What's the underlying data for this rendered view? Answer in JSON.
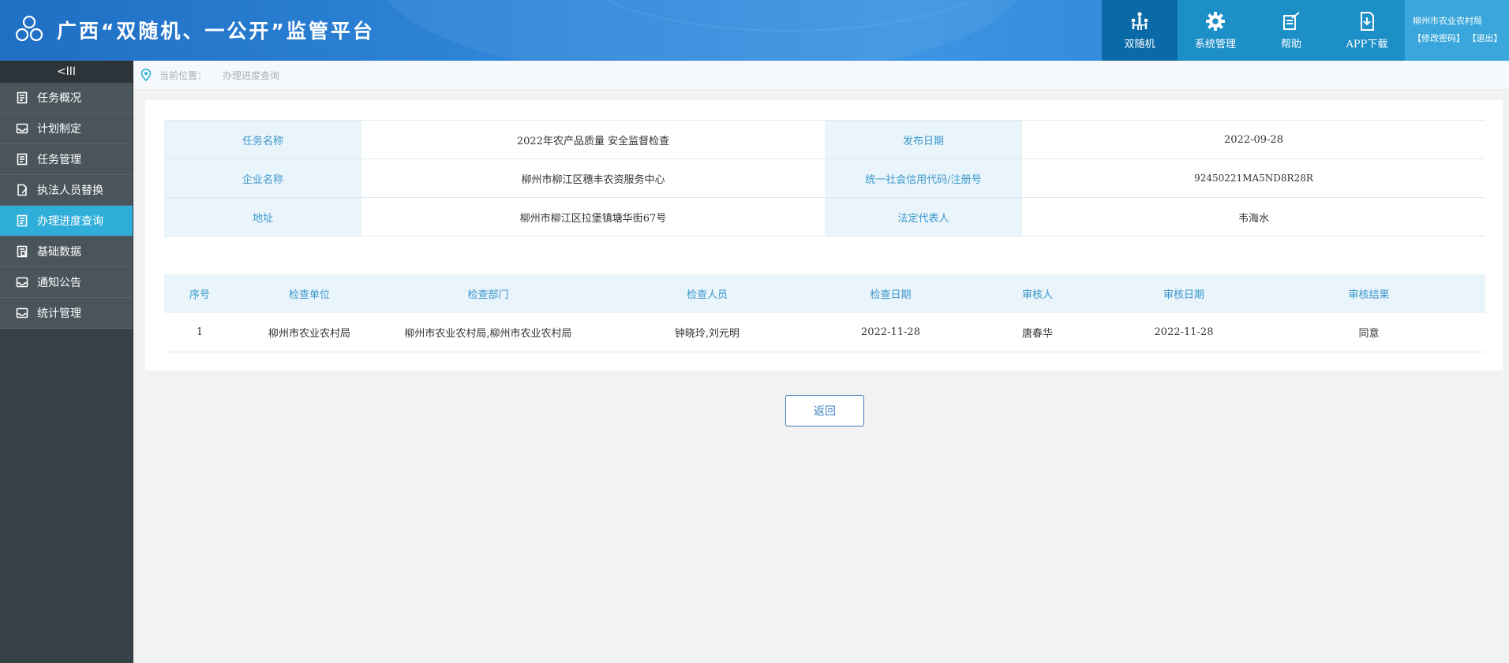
{
  "header": {
    "title": "广西“双随机、一公开”监管平台",
    "nav": [
      {
        "label": "双随机",
        "icon": "people-tree-icon",
        "active": true
      },
      {
        "label": "系统管理",
        "icon": "gear-icon",
        "active": false
      },
      {
        "label": "帮助",
        "icon": "edit-doc-icon",
        "active": false
      },
      {
        "label": "APP下载",
        "icon": "download-doc-icon",
        "active": false
      }
    ],
    "user": {
      "org": "柳州市农业农村局",
      "change_password": "【修改密码】",
      "logout": "【退出】"
    }
  },
  "sidebar": {
    "collapse_label": "<III",
    "items": [
      {
        "label": "任务概况",
        "active": false
      },
      {
        "label": "计划制定",
        "active": false
      },
      {
        "label": "任务管理",
        "active": false
      },
      {
        "label": "执法人员替换",
        "active": false
      },
      {
        "label": "办理进度查询",
        "active": true
      },
      {
        "label": "基础数据",
        "active": false
      },
      {
        "label": "通知公告",
        "active": false
      },
      {
        "label": "统计管理",
        "active": false
      }
    ]
  },
  "breadcrumb": {
    "prefix": "当前位置：",
    "current": "办理进度查询"
  },
  "info": {
    "task_name_label": "任务名称",
    "task_name": "2022年农产品质量 安全监督检查",
    "publish_date_label": "发布日期",
    "publish_date": "2022-09-28",
    "company_label": "企业名称",
    "company": "柳州市柳江区穗丰农资服务中心",
    "credit_code_label": "统一社会信用代码/注册号",
    "credit_code": "92450221MA5ND8R28R",
    "address_label": "地址",
    "address": "柳州市柳江区拉堡镇塘华街67号",
    "legal_rep_label": "法定代表人",
    "legal_rep": "韦海水"
  },
  "inspections": {
    "columns": [
      "序号",
      "检查单位",
      "检查部门",
      "检查人员",
      "检查日期",
      "审核人",
      "审核日期",
      "审核结果"
    ],
    "rows": [
      [
        "1",
        "柳州市农业农村局",
        "柳州市农业农村局,柳州市农业农村局",
        "钟晓玲,刘元明",
        "2022-11-28",
        "唐春华",
        "2022-11-28",
        "同意"
      ]
    ]
  },
  "actions": {
    "back_label": "返回"
  },
  "colors": {
    "header_blue": "#2f86d8",
    "nav_active": "#0a6aa8",
    "sidebar_bg": "#374148",
    "sidebar_active": "#2eaed9",
    "label_blue": "#3a98cc"
  }
}
